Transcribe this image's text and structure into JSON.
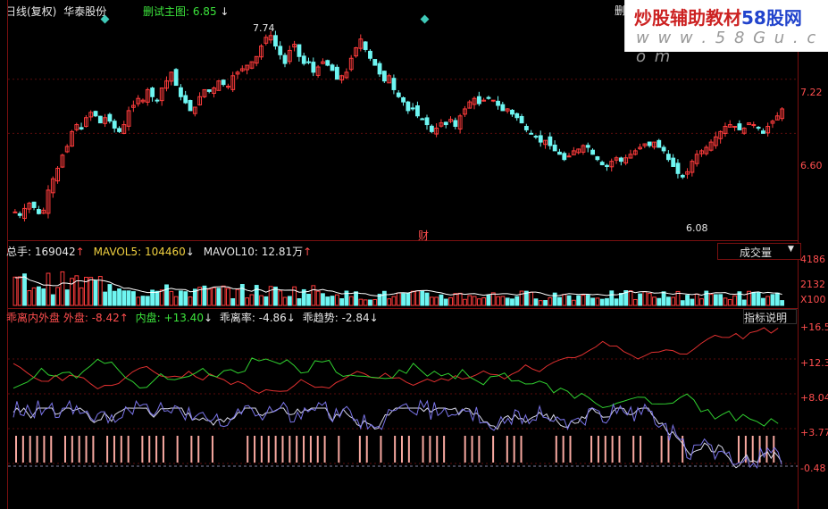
{
  "header": {
    "period": "日线(复权)",
    "stock": "华泰股份",
    "formula": "删试主图: 6.85",
    "formula_arrow": "↓",
    "right_tag": "删"
  },
  "watermark": {
    "line1_a": "炒股辅助教材",
    "line1_b": "58股网",
    "line2": "w w w . 5 8 G u . c o m"
  },
  "price_chart": {
    "high_label": "7.74",
    "low_label": "6.08",
    "marker": "财",
    "ticks": [
      "7.22",
      "6.60"
    ],
    "up_color": "#ff3c3c",
    "down_color": "#6ef6f2",
    "closes": [
      5.7,
      5.66,
      5.74,
      5.8,
      5.75,
      5.68,
      5.72,
      5.95,
      6.08,
      6.2,
      6.35,
      6.45,
      6.62,
      6.7,
      6.65,
      6.78,
      6.84,
      6.8,
      6.72,
      6.78,
      6.74,
      6.66,
      6.62,
      6.7,
      6.86,
      6.92,
      7.0,
      6.98,
      7.1,
      7.02,
      6.98,
      7.12,
      7.2,
      7.3,
      7.15,
      7.02,
      6.95,
      6.86,
      6.9,
      7.02,
      7.1,
      7.08,
      7.12,
      7.2,
      7.16,
      7.14,
      7.26,
      7.3,
      7.34,
      7.38,
      7.42,
      7.48,
      7.6,
      7.7,
      7.72,
      7.6,
      7.5,
      7.4,
      7.55,
      7.62,
      7.48,
      7.4,
      7.42,
      7.3,
      7.36,
      7.42,
      7.38,
      7.32,
      7.22,
      7.26,
      7.3,
      7.46,
      7.58,
      7.68,
      7.56,
      7.46,
      7.38,
      7.28,
      7.2,
      7.26,
      7.1,
      7.02,
      6.96,
      6.86,
      6.88,
      6.8,
      6.76,
      6.7,
      6.62,
      6.66,
      6.72,
      6.7,
      6.76,
      6.68,
      6.8,
      6.88,
      6.96,
      7.0,
      6.94,
      6.98,
      7.0,
      6.98,
      6.92,
      6.86,
      6.88,
      6.82,
      6.78,
      6.72,
      6.64,
      6.6,
      6.56,
      6.5,
      6.52,
      6.46,
      6.4,
      6.36,
      6.3,
      6.34,
      6.4,
      6.42,
      6.46,
      6.44,
      6.36,
      6.3,
      6.24,
      6.22,
      6.28,
      6.32,
      6.28,
      6.32,
      6.36,
      6.4,
      6.44,
      6.48,
      6.46,
      6.5,
      6.44,
      6.4,
      6.3,
      6.22,
      6.14,
      6.1,
      6.16,
      6.28,
      6.36,
      6.4,
      6.44,
      6.5,
      6.56,
      6.62,
      6.68,
      6.7,
      6.68,
      6.64,
      6.66,
      6.72,
      6.7,
      6.66,
      6.6,
      6.68,
      6.74,
      6.8,
      6.88
    ],
    "ohlc_period": "daily"
  },
  "volume_chart": {
    "label_total": "总手: 169042",
    "label_mavol5": "MAVOL5: 104460",
    "label_mavol10": "MAVOL10: 12.81万",
    "arrow_up": "↑",
    "arrow_down": "↓",
    "dropdown": "成交量",
    "dropdown_caret": "▼",
    "ticks": [
      "4186",
      "2132",
      "X100"
    ]
  },
  "indicator": {
    "name": "乖离内外盘",
    "outer_label": "外盘:",
    "outer_value": "-8.42",
    "inner_label": "内盘:",
    "inner_value": "+13.40",
    "bias_label": "乖离率:",
    "bias_value": "-4.86",
    "trend_label": "乖趋势:",
    "trend_value": "-2.84",
    "help_button": "指标说明",
    "ticks": [
      "+16.5",
      "+12.3",
      "+8.04",
      "+3.77",
      "-0.48"
    ]
  }
}
